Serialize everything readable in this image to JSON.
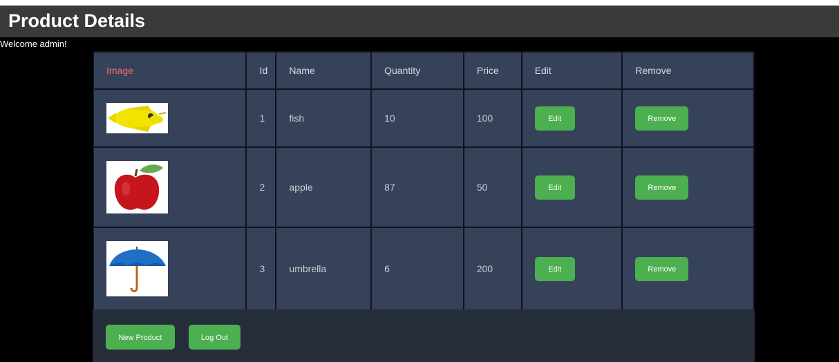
{
  "header": {
    "title": "Product Details"
  },
  "welcome": "Welcome admin!",
  "table": {
    "columns": [
      "Image",
      "Id",
      "Name",
      "Quantity",
      "Price",
      "Edit",
      "Remove"
    ],
    "rows": [
      {
        "image": "fish-image",
        "id": "1",
        "name": "fish",
        "quantity": "10",
        "price": "100",
        "edit": "Edit",
        "remove": "Remove"
      },
      {
        "image": "apple-image",
        "id": "2",
        "name": "apple",
        "quantity": "87",
        "price": "50",
        "edit": "Edit",
        "remove": "Remove"
      },
      {
        "image": "umbrella-image",
        "id": "3",
        "name": "umbrella",
        "quantity": "6",
        "price": "200",
        "edit": "Edit",
        "remove": "Remove"
      }
    ]
  },
  "footer": {
    "new_product": "New Product",
    "log_out": "Log Out"
  },
  "colors": {
    "accent": "#4caf50",
    "header_bg": "#3a3a3a",
    "table_bg": "#36415a",
    "image_header": "#f06a6a"
  }
}
